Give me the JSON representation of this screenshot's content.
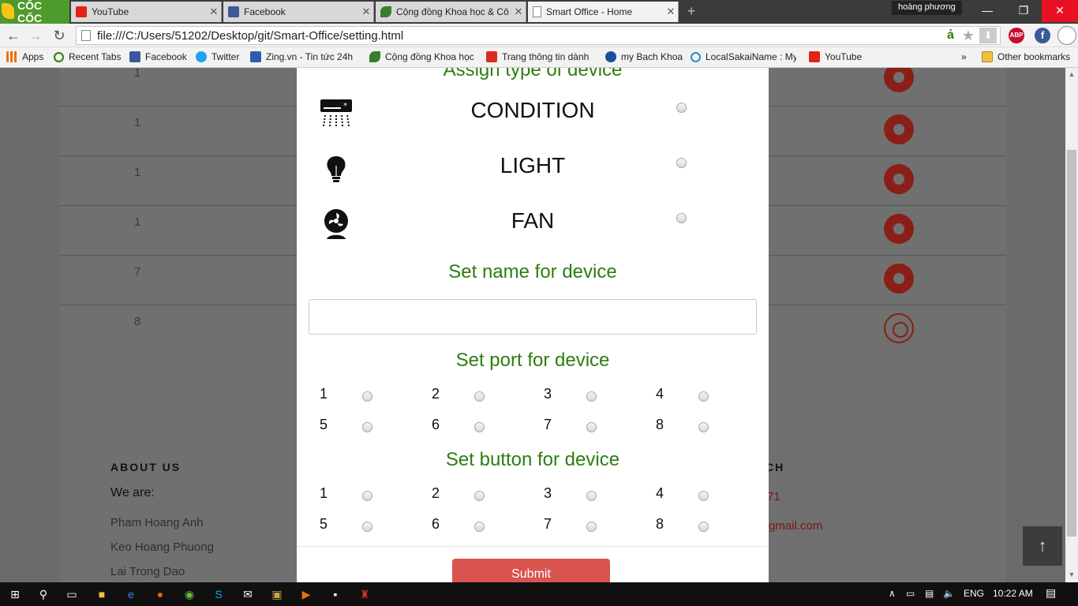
{
  "browser": {
    "brand": "CỐC CỐC",
    "tabs": [
      {
        "label": "YouTube",
        "icon": "youtube-icon",
        "color": "#e62117"
      },
      {
        "label": "Facebook",
        "icon": "facebook-icon",
        "color": "#3b5998"
      },
      {
        "label": "Cộng đồng Khoa học & Cô",
        "icon": "leaf-icon",
        "color": "#3a7d2c"
      },
      {
        "label": "Smart Office - Home",
        "icon": "page-icon",
        "color": "#888888",
        "active": true
      }
    ],
    "user_name": "hoàng phương",
    "url": "file:///C:/Users/51202/Desktop/git/Smart-Office/setting.html",
    "abp_label": "ABP",
    "fb_label": "f",
    "bookmarks": [
      {
        "label": "Apps",
        "icon": "apps-grid-icon",
        "color": "#e8710a"
      },
      {
        "label": "Recent Tabs",
        "icon": "recent-tabs-icon",
        "color": "#2e7d10"
      },
      {
        "label": "Facebook",
        "icon": "facebook-icon",
        "color": "#3b5998"
      },
      {
        "label": "Twitter",
        "icon": "twitter-icon",
        "color": "#1da1f2"
      },
      {
        "label": "Zing.vn - Tin tức 24h,",
        "icon": "zing-icon",
        "color": "#2a5db0"
      },
      {
        "label": "Cộng đồng Khoa học",
        "icon": "leaf-icon",
        "color": "#3a7d2c"
      },
      {
        "label": "Trang thông tin dành",
        "icon": "gk-icon",
        "color": "#d62d20"
      },
      {
        "label": "my Bach Khoa",
        "icon": "mybk-icon",
        "color": "#1a4fa0"
      },
      {
        "label": "LocalSakaiName : My",
        "icon": "sakai-icon",
        "color": "#2a8fc7"
      },
      {
        "label": "YouTube",
        "icon": "youtube-icon",
        "color": "#e62117"
      }
    ],
    "more_label": "»",
    "other_bookmarks": "Other bookmarks"
  },
  "background_table": {
    "rows": [
      {
        "num": "1",
        "state": "filled"
      },
      {
        "num": "1",
        "state": "filled"
      },
      {
        "num": "1",
        "state": "filled"
      },
      {
        "num": "1",
        "state": "filled"
      },
      {
        "num": "7",
        "state": "filled"
      },
      {
        "num": "8",
        "state": "ring"
      }
    ]
  },
  "footer": {
    "about_heading": "ABOUT US",
    "we_are": "We are:",
    "members": [
      "Pham Hoang Anh",
      "Keo Hoang Phuong",
      "Lai Trong Dao"
    ],
    "contact_heading_tail": "CH",
    "phone_tail": "71",
    "email_tail": "gmail.com"
  },
  "modal": {
    "assign_heading": "Assign type of device",
    "types": [
      {
        "label": "CONDITION",
        "icon": "air-conditioner-icon"
      },
      {
        "label": "LIGHT",
        "icon": "light-bulb-icon"
      },
      {
        "label": "FAN",
        "icon": "fan-icon"
      }
    ],
    "name_heading": "Set name for device",
    "name_value": "",
    "port_heading": "Set port for device",
    "ports": [
      "1",
      "2",
      "3",
      "4",
      "5",
      "6",
      "7",
      "8"
    ],
    "button_heading": "Set button for device",
    "buttons": [
      "1",
      "2",
      "3",
      "4",
      "5",
      "6",
      "7",
      "8"
    ],
    "submit_label": "Submit"
  },
  "taskbar": {
    "lang": "ENG",
    "time": "10:22 AM"
  },
  "colors": {
    "accent_green": "#2e7d10",
    "submit_red": "#d9534f",
    "dot_red": "#8a1f17"
  }
}
